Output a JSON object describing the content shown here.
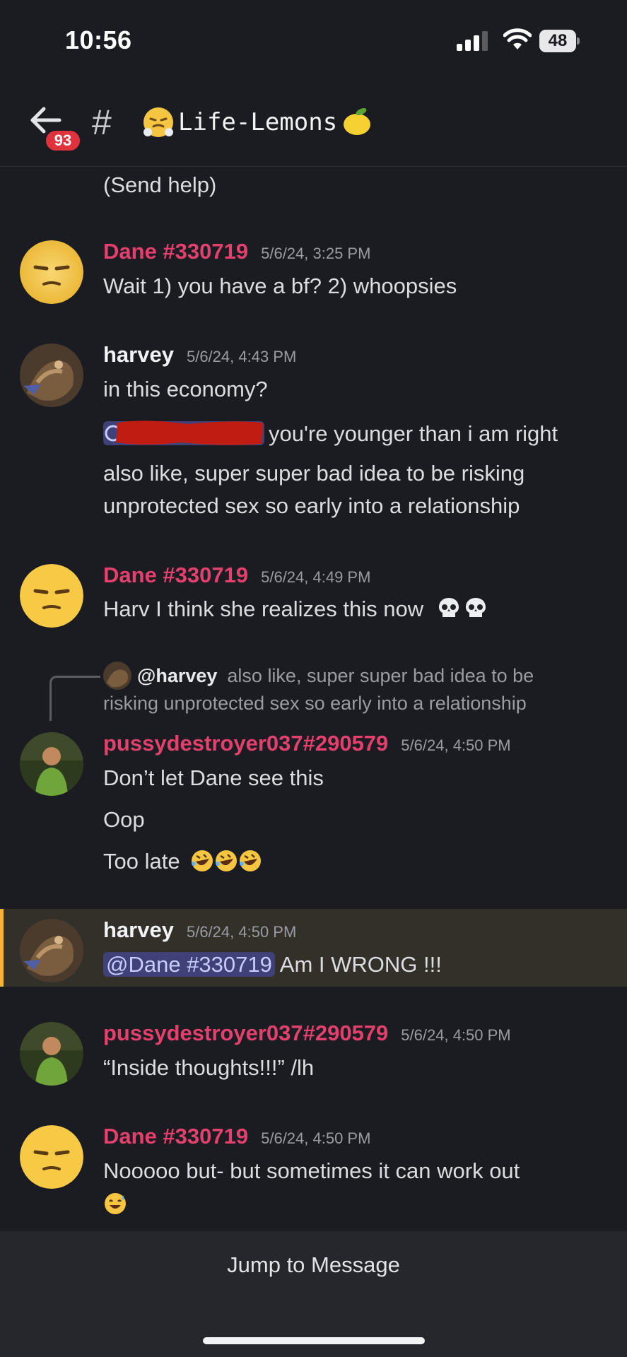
{
  "status": {
    "time": "10:56",
    "battery": "48"
  },
  "header": {
    "badge": "93",
    "hash": "#",
    "channel_name": "Life-Lemons"
  },
  "messages": {
    "m0": {
      "text": "(Send help)"
    },
    "m1": {
      "author": "Dane #330719",
      "time": "5/6/24, 3:25 PM",
      "text": "Wait 1) you have a bf? 2) whoopsies"
    },
    "m2": {
      "author": "harvey",
      "time": "5/6/24, 4:43 PM",
      "line1": "in this economy?",
      "line2": "you're younger than i am right",
      "line3": "also like, super super bad idea to be risking",
      "line4": "unprotected sex so early into a relationship"
    },
    "m3": {
      "author": "Dane #330719",
      "time": "5/6/24, 4:49 PM",
      "text": "Harv I think she realizes this now"
    },
    "reply": {
      "author": "@harvey",
      "text1": "also like, super super bad idea to be",
      "text2": "risking unprotected sex so early into a relationship"
    },
    "m4": {
      "author": "pussydestroyer037#290579",
      "time": "5/6/24, 4:50 PM",
      "line1": "Don’t let Dane see this",
      "line2": "Oop",
      "line3": "Too late"
    },
    "m5": {
      "author": "harvey",
      "time": "5/6/24, 4:50 PM",
      "mention": "@Dane #330719",
      "text": "Am I WRONG !!!"
    },
    "m6": {
      "author": "pussydestroyer037#290579",
      "time": "5/6/24, 4:50 PM",
      "text": "“Inside thoughts!!!” /lh"
    },
    "m7": {
      "author": "Dane #330719",
      "time": "5/6/24, 4:50 PM",
      "text": "Nooooo but- but sometimes it can work out"
    }
  },
  "footer": {
    "jump_label": "Jump to Message"
  },
  "colors": {
    "background": "#1b1c21",
    "author_pink": "#e4406e",
    "mention_bg": "#3f4178",
    "highlight_bar": "#f0b232",
    "badge_red": "#e0323c"
  },
  "icons": [
    "back-arrow-icon",
    "signal-icon",
    "wifi-icon",
    "battery-icon",
    "hash-icon",
    "steam-face-emoji",
    "lemon-emoji",
    "skull-emoji",
    "rofl-emoji",
    "sweat-smile-emoji",
    "unamused-face-avatar"
  ]
}
